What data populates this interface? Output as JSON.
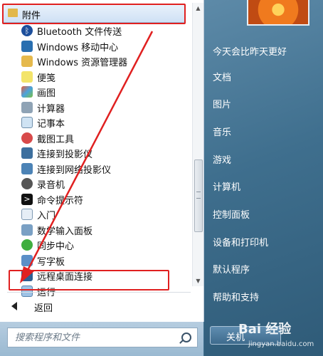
{
  "folder": {
    "label": "附件"
  },
  "items": [
    {
      "label": "Bluetooth 文件传送",
      "icon": "bluetooth-icon"
    },
    {
      "label": "Windows 移动中心",
      "icon": "mobility-center-icon"
    },
    {
      "label": "Windows 资源管理器",
      "icon": "explorer-icon"
    },
    {
      "label": "便笺",
      "icon": "sticky-notes-icon"
    },
    {
      "label": "画图",
      "icon": "paint-icon"
    },
    {
      "label": "计算器",
      "icon": "calculator-icon"
    },
    {
      "label": "记事本",
      "icon": "notepad-icon"
    },
    {
      "label": "截图工具",
      "icon": "snipping-tool-icon"
    },
    {
      "label": "连接到投影仪",
      "icon": "projector-icon"
    },
    {
      "label": "连接到网络投影仪",
      "icon": "network-projector-icon"
    },
    {
      "label": "录音机",
      "icon": "sound-recorder-icon"
    },
    {
      "label": "命令提示符",
      "icon": "command-prompt-icon"
    },
    {
      "label": "入门",
      "icon": "getting-started-icon"
    },
    {
      "label": "数学输入面板",
      "icon": "math-input-icon"
    },
    {
      "label": "同步中心",
      "icon": "sync-center-icon"
    },
    {
      "label": "写字板",
      "icon": "wordpad-icon"
    },
    {
      "label": "远程桌面连接",
      "icon": "remote-desktop-icon"
    },
    {
      "label": "运行",
      "icon": "run-icon"
    }
  ],
  "back": {
    "label": "返回"
  },
  "search": {
    "placeholder": "搜索程序和文件"
  },
  "right_menu": [
    {
      "label": "今天会比昨天更好"
    },
    {
      "label": "文档"
    },
    {
      "label": "图片"
    },
    {
      "label": "音乐"
    },
    {
      "label": "游戏"
    },
    {
      "label": "计算机"
    },
    {
      "label": "控制面板"
    },
    {
      "label": "设备和打印机"
    },
    {
      "label": "默认程序"
    },
    {
      "label": "帮助和支持"
    }
  ],
  "shutdown": {
    "label": "关机"
  },
  "watermark": {
    "logo": "Bai 经验",
    "url": "jingyan.baidu.com"
  },
  "colors": {
    "annotation": "#e02020",
    "accent": "#3f6f8e"
  }
}
